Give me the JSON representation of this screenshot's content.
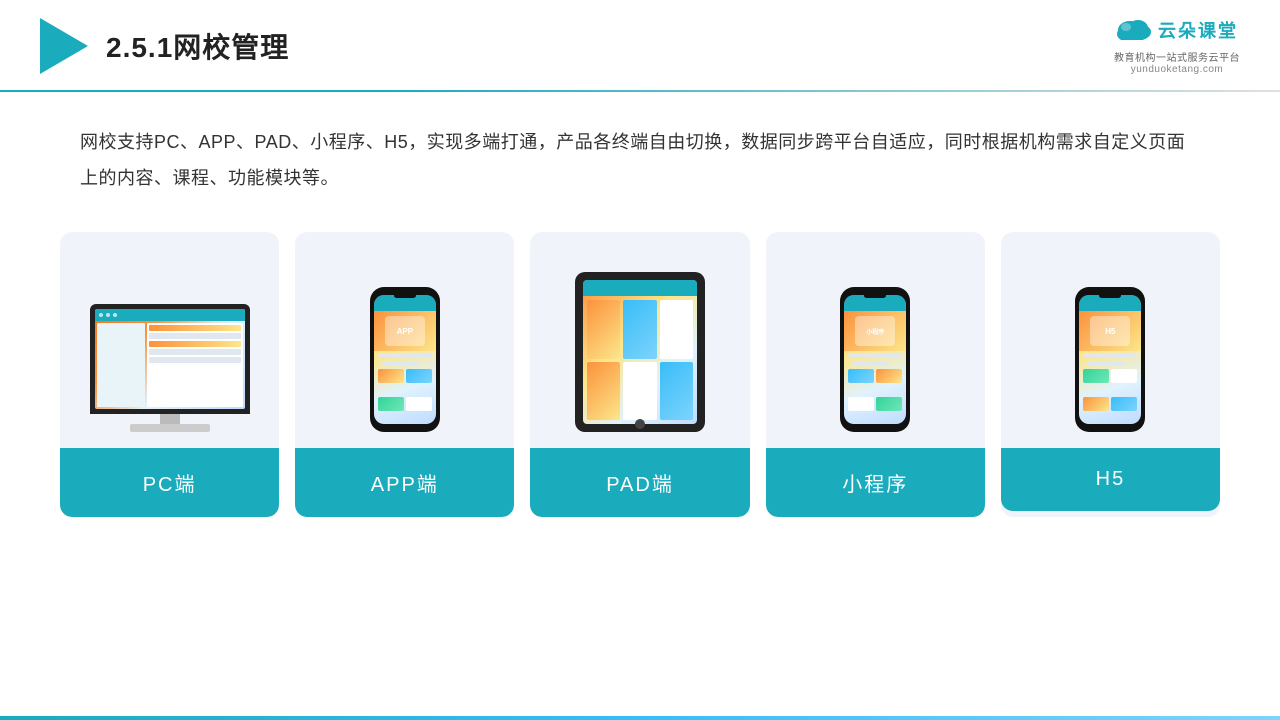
{
  "header": {
    "title": "2.5.1网校管理",
    "brand_cn": "云朵课堂",
    "brand_url": "yunduoketang.com",
    "brand_tagline": "教育机构一站\n式服务云平台"
  },
  "description": {
    "text": "网校支持PC、APP、PAD、小程序、H5，实现多端打通，产品各终端自由切换，数据同步跨平台自适应，同时根据机构需求自定义页面上的内容、课程、功能模块等。"
  },
  "cards": [
    {
      "id": "pc",
      "label": "PC端"
    },
    {
      "id": "app",
      "label": "APP端"
    },
    {
      "id": "pad",
      "label": "PAD端"
    },
    {
      "id": "miniprogram",
      "label": "小程序"
    },
    {
      "id": "h5",
      "label": "H5"
    }
  ]
}
